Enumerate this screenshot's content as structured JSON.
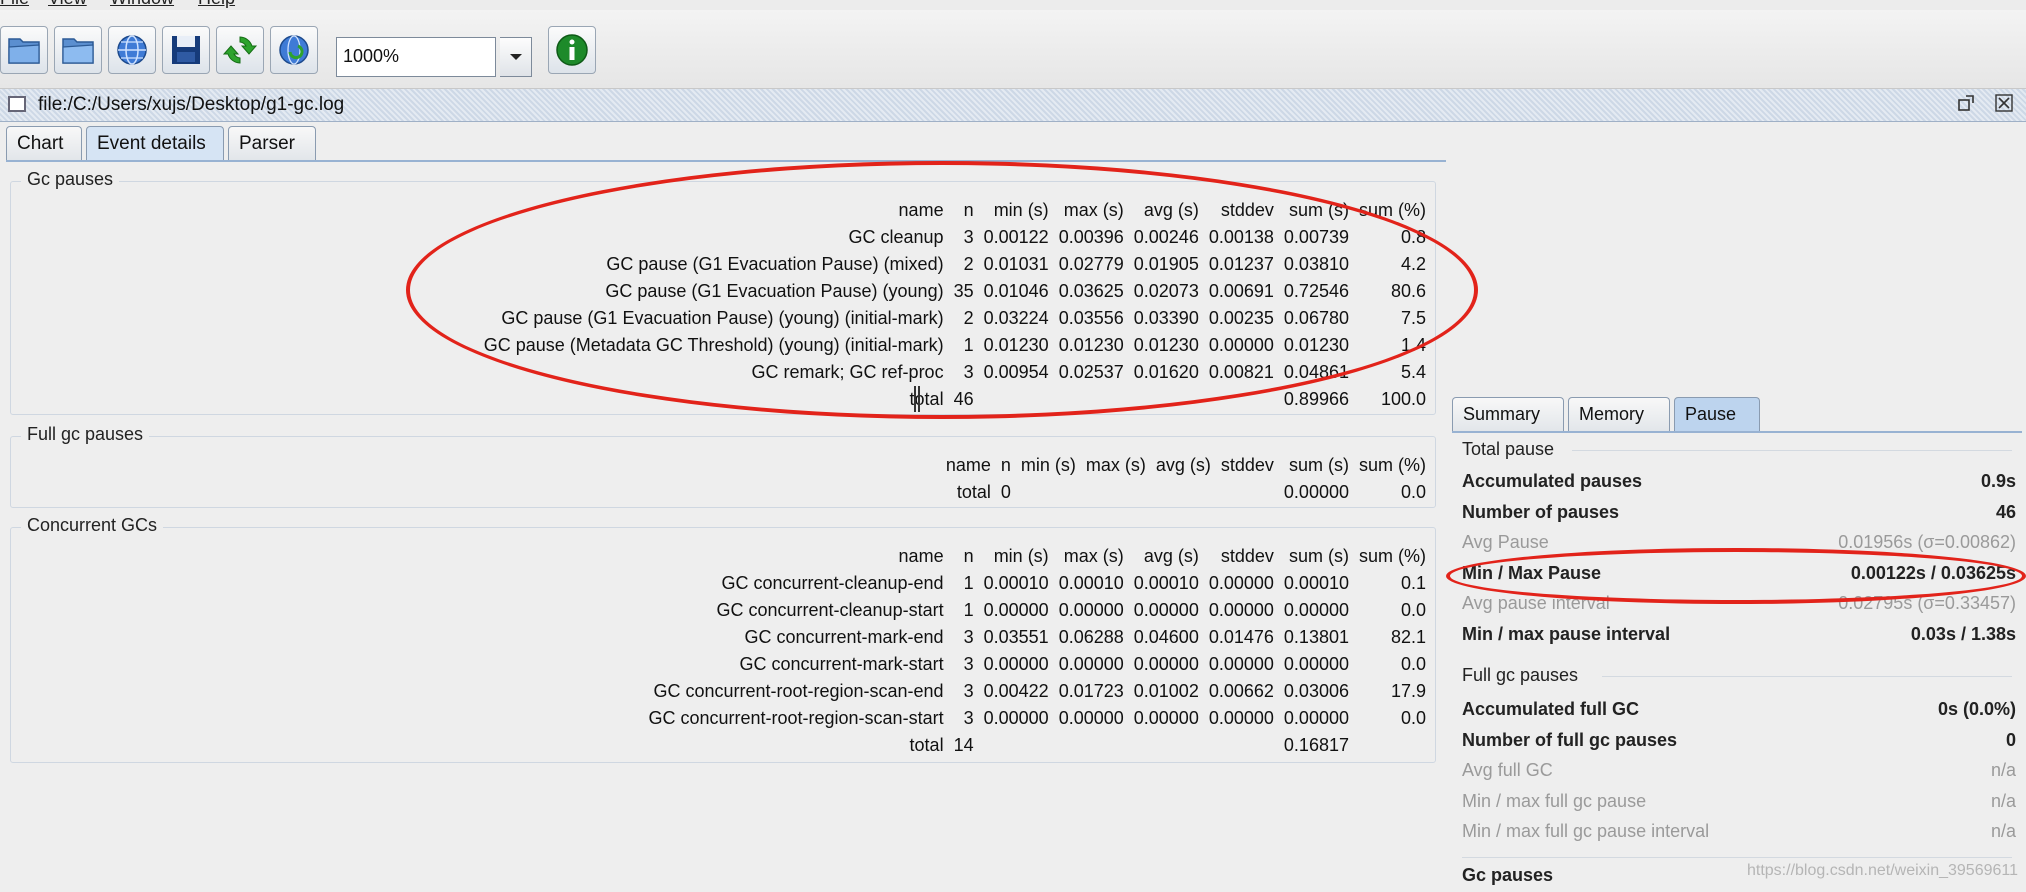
{
  "menu": [
    "File",
    "View",
    "Window",
    "Help"
  ],
  "toolbar": {
    "icons": [
      "open-file-icon",
      "open-folder-icon",
      "open-url-icon",
      "save-icon",
      "refresh-icon",
      "watch-icon"
    ],
    "zoom_value": "1000%",
    "info_icon": "info-icon"
  },
  "window": {
    "title": "file:/C:/Users/xujs/Desktop/g1-gc.log"
  },
  "tabs": [
    "Chart",
    "Event details",
    "Parser"
  ],
  "active_tab": "Event details",
  "columns": [
    "name",
    "n",
    "min (s)",
    "max (s)",
    "avg (s)",
    "stddev",
    "sum (s)",
    "sum (%)"
  ],
  "gc_pauses": {
    "label": "Gc pauses",
    "rows": [
      [
        "GC cleanup",
        "3",
        "0.00122",
        "0.00396",
        "0.00246",
        "0.00138",
        "0.00739",
        "0.8"
      ],
      [
        "GC pause (G1 Evacuation Pause) (mixed)",
        "2",
        "0.01031",
        "0.02779",
        "0.01905",
        "0.01237",
        "0.03810",
        "4.2"
      ],
      [
        "GC pause (G1 Evacuation Pause) (young)",
        "35",
        "0.01046",
        "0.03625",
        "0.02073",
        "0.00691",
        "0.72546",
        "80.6"
      ],
      [
        "GC pause (G1 Evacuation Pause) (young) (initial-mark)",
        "2",
        "0.03224",
        "0.03556",
        "0.03390",
        "0.00235",
        "0.06780",
        "7.5"
      ],
      [
        "GC pause (Metadata GC Threshold) (young) (initial-mark)",
        "1",
        "0.01230",
        "0.01230",
        "0.01230",
        "0.00000",
        "0.01230",
        "1.4"
      ],
      [
        "GC remark; GC ref-proc",
        "3",
        "0.00954",
        "0.02537",
        "0.01620",
        "0.00821",
        "0.04861",
        "5.4"
      ]
    ],
    "total": [
      "total",
      "46",
      "",
      "",
      "",
      "",
      "0.89966",
      "100.0"
    ]
  },
  "full_gc_pauses": {
    "label": "Full gc pauses",
    "total": [
      "total",
      "0",
      "",
      "",
      "",
      "",
      "0.00000",
      "0.0"
    ]
  },
  "concurrent_gcs": {
    "label": "Concurrent GCs",
    "rows": [
      [
        "GC concurrent-cleanup-end",
        "1",
        "0.00010",
        "0.00010",
        "0.00010",
        "0.00000",
        "0.00010",
        "0.1"
      ],
      [
        "GC concurrent-cleanup-start",
        "1",
        "0.00000",
        "0.00000",
        "0.00000",
        "0.00000",
        "0.00000",
        "0.0"
      ],
      [
        "GC concurrent-mark-end",
        "3",
        "0.03551",
        "0.06288",
        "0.04600",
        "0.01476",
        "0.13801",
        "82.1"
      ],
      [
        "GC concurrent-mark-start",
        "3",
        "0.00000",
        "0.00000",
        "0.00000",
        "0.00000",
        "0.00000",
        "0.0"
      ],
      [
        "GC concurrent-root-region-scan-end",
        "3",
        "0.00422",
        "0.01723",
        "0.01002",
        "0.00662",
        "0.03006",
        "17.9"
      ],
      [
        "GC concurrent-root-region-scan-start",
        "3",
        "0.00000",
        "0.00000",
        "0.00000",
        "0.00000",
        "0.00000",
        "0.0"
      ]
    ],
    "total": [
      "total",
      "14",
      "",
      "",
      "",
      "",
      "0.16817",
      ""
    ]
  },
  "right_tabs": [
    "Summary",
    "Memory",
    "Pause"
  ],
  "right_active_tab": "Pause",
  "total_pause": {
    "label": "Total pause",
    "rows": [
      {
        "k": "Accumulated pauses",
        "v": "0.9s",
        "dim": false
      },
      {
        "k": "Number of pauses",
        "v": "46",
        "dim": false
      },
      {
        "k": "Avg Pause",
        "v": "0.01956s (σ=0.00862)",
        "dim": true
      },
      {
        "k": "Min / Max Pause",
        "v": "0.00122s / 0.03625s",
        "dim": false
      },
      {
        "k": "Avg pause interval",
        "v": "0.02795s (σ=0.33457)",
        "dim": true
      },
      {
        "k": "Min / max pause interval",
        "v": "0.03s / 1.38s",
        "dim": false
      }
    ]
  },
  "full_gc_panel": {
    "label": "Full gc pauses",
    "rows": [
      {
        "k": "Accumulated full GC",
        "v": "0s (0.0%)",
        "dim": false
      },
      {
        "k": "Number of full gc pauses",
        "v": "0",
        "dim": false
      },
      {
        "k": "Avg full GC",
        "v": "n/a",
        "dim": true
      },
      {
        "k": "Min / max full gc pause",
        "v": "n/a",
        "dim": true
      },
      {
        "k": "Min / max full gc pause interval",
        "v": "n/a",
        "dim": true
      }
    ]
  },
  "gc_pauses_panel_label": "Gc pauses",
  "watermark": "https://blog.csdn.net/weixin_39569611",
  "highlight_color": "#e2231a"
}
